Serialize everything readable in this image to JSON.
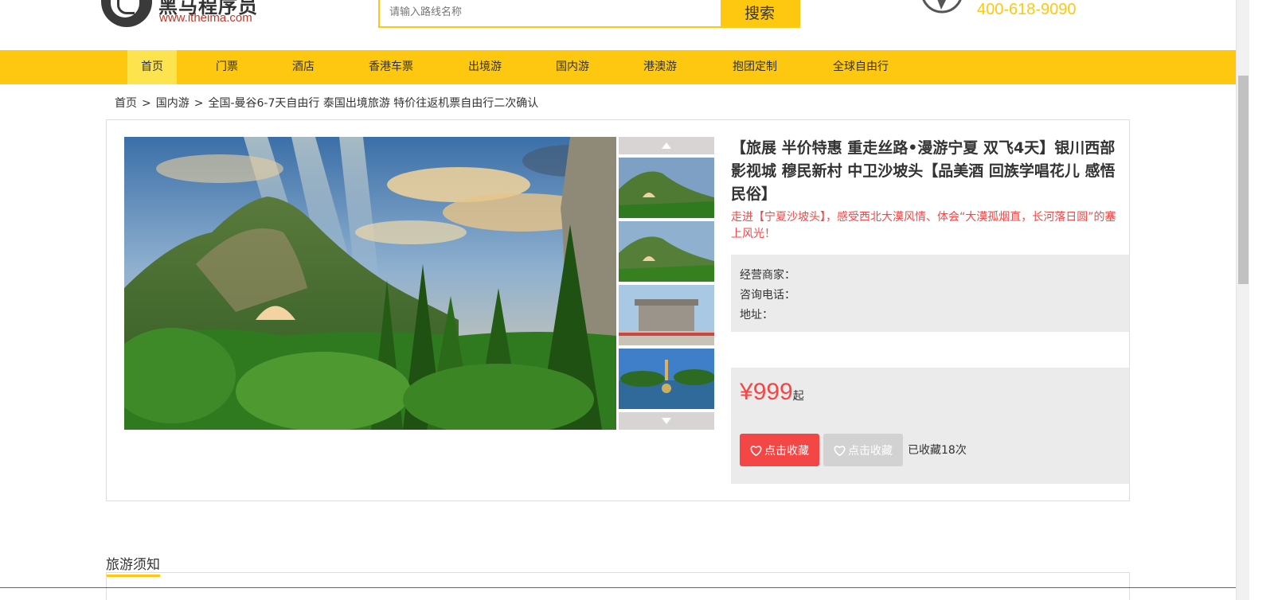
{
  "header": {
    "logo_cn": "黑马程序员",
    "logo_en": "www.itheima.com",
    "search_placeholder": "请输入路线名称",
    "search_button": "搜索",
    "phone": "400-618-9090"
  },
  "nav": {
    "items": [
      {
        "label": "首页",
        "active": true
      },
      {
        "label": "门票"
      },
      {
        "label": "酒店"
      },
      {
        "label": "香港车票"
      },
      {
        "label": "出境游"
      },
      {
        "label": "国内游"
      },
      {
        "label": "港澳游"
      },
      {
        "label": "抱团定制"
      },
      {
        "label": "全球自由行"
      }
    ]
  },
  "breadcrumb": {
    "items": [
      "首页",
      "国内游",
      "全国-曼谷6-7天自由行 泰国出境旅游 特价往返机票自由行二次确认"
    ],
    "separator": ">"
  },
  "product": {
    "title": "【旅展 半价特惠 重走丝路•漫游宁夏 双飞4天】银川西部影视城 穆民新村 中卫沙坡头【品美酒 回族学唱花儿 感悟民俗】",
    "subtitle": "走进【宁夏沙坡头】，感受西北大漠风情、体会“大漠孤烟直，长河落日圆”的塞上风光！",
    "seller_label": "经营商家：",
    "phone_label": "咨询电话：",
    "address_label": "地址：",
    "price_symbol": "¥",
    "price": "999",
    "price_unit": "起",
    "fav_button": "点击收藏",
    "fav_button_disabled": "点击收藏",
    "fav_count": "已收藏18次"
  },
  "notice": {
    "title": "旅游须知"
  },
  "colors": {
    "brand_yellow": "#fdc80f",
    "accent_red": "#f54646",
    "panel_grey": "#ebebeb"
  }
}
